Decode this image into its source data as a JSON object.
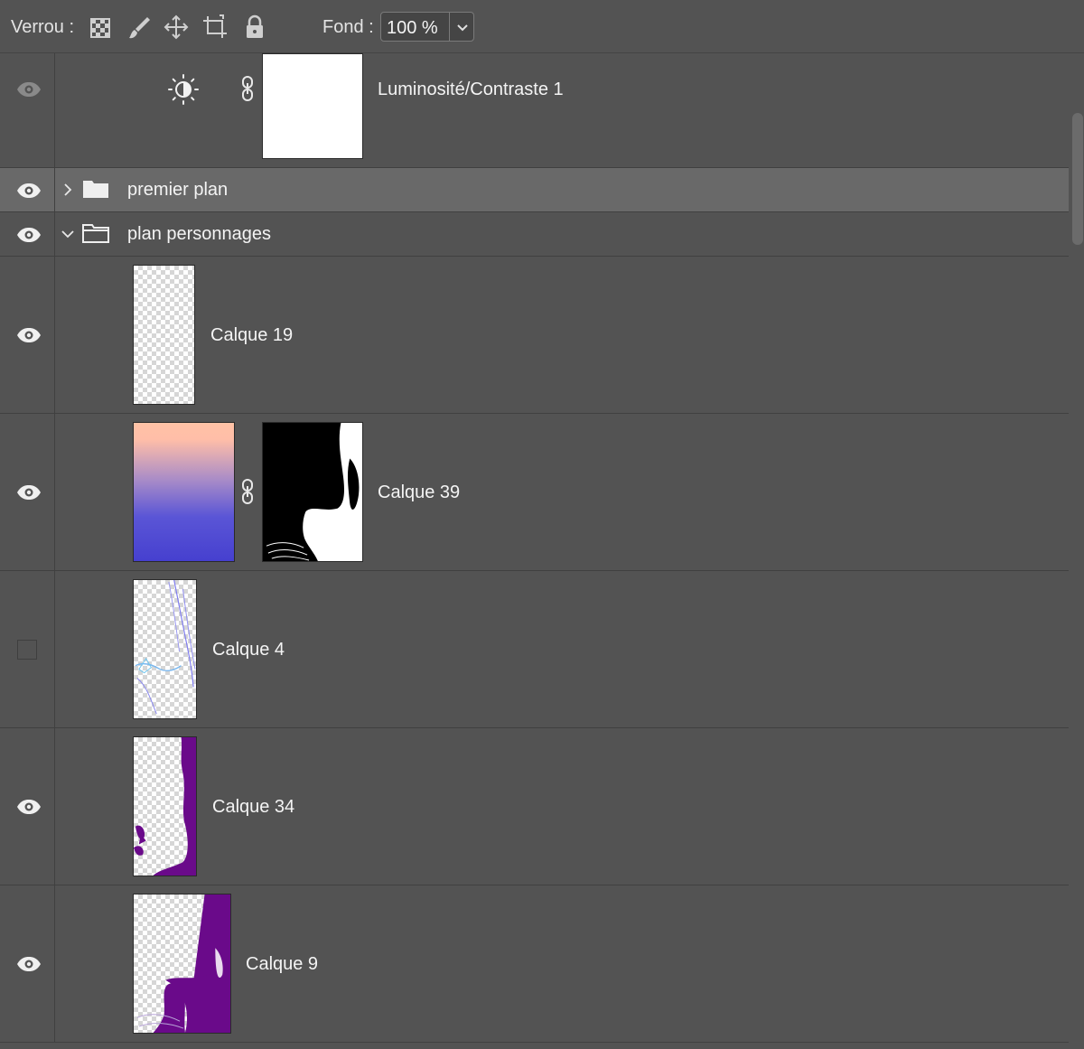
{
  "toolbar": {
    "lock_label": "Verrou :",
    "lock_icons": [
      "lock-transparent-pixels-icon",
      "lock-image-pixels-icon",
      "lock-position-icon",
      "lock-artboard-icon",
      "lock-all-icon"
    ],
    "fill_label": "Fond :",
    "fill_value": "100 %"
  },
  "layers": [
    {
      "name": "Luminosité/Contraste 1",
      "type": "adjustment",
      "visible": true,
      "dim_eye": true,
      "icon": "brightness-contrast-icon",
      "mask": "white"
    },
    {
      "name": "premier plan",
      "type": "group",
      "visible": true,
      "expanded": false,
      "selected": true
    },
    {
      "name": "plan personnages",
      "type": "group",
      "visible": true,
      "expanded": true
    },
    {
      "name": "Calque 19",
      "type": "pixel",
      "visible": true,
      "thumb": "transparent"
    },
    {
      "name": "Calque 39",
      "type": "fill-with-mask",
      "visible": true,
      "thumb": "gradient",
      "mask": "silhouette"
    },
    {
      "name": "Calque 4",
      "type": "pixel",
      "visible": false,
      "thumb": "sketch-lines"
    },
    {
      "name": "Calque 34",
      "type": "pixel",
      "visible": true,
      "thumb": "purple-edge"
    },
    {
      "name": "Calque 9",
      "type": "pixel",
      "visible": true,
      "thumb": "purple-shape"
    }
  ],
  "colors": {
    "panel": "#535353",
    "selected": "#696969",
    "gradient_top": "#ffc2a6",
    "gradient_bottom": "#4a40d0",
    "purple": "#6a0a8a"
  }
}
